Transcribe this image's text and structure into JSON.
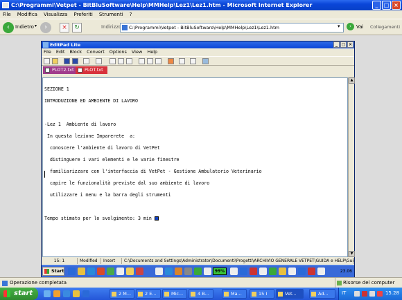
{
  "ie": {
    "title": "C:\\Programmi\\Vetpet - BitBluSoftware\\Help\\MMHelp\\Lez1\\Lez1.htm - Microsoft Internet Explorer",
    "menu": [
      "File",
      "Modifica",
      "Visualizza",
      "Preferiti",
      "Strumenti",
      "?"
    ],
    "back_label": "Indietro",
    "address_label": "Indirizzo",
    "address_value": "C:\\Programmi\\Vetpet - BitBluSoftware\\Help\\MMHelp\\Lez1\\Lez1.htm",
    "go_label": "Vai",
    "links_label": "Collegamenti",
    "status_text": "Operazione completata",
    "zone_text": "Risorse del computer"
  },
  "editpad": {
    "title": "EditPad Lite",
    "menu": [
      "File",
      "Edit",
      "Block",
      "Convert",
      "Options",
      "View",
      "Help"
    ],
    "tabs": [
      "PLOT2.txt",
      "PLOT.txt"
    ],
    "lines": [
      "SEZIONE 1",
      "INTRODUZIONE ED AMBIENTE DI LAVORO",
      "",
      "-Lez 1  Ambiente di lavoro",
      " In questa lezione Imparerete  a:",
      "  conoscere l'ambiente di lavoro di VetPet",
      "  distinguere i vari elementi e le varie finestre",
      "  familiarizzare con l'interfaccia di VetPet - Gestione Ambulatorio Veterinario",
      "  capire le funzionalità previste dal suo ambiente di lavoro",
      "  utilizzare i menu e la barra degli strumenti",
      "",
      "Tempo stimato per lo svolgimento: 3 min "
    ],
    "status": {
      "position": "15: 1",
      "modified": "Modified",
      "insert": "Insert",
      "path": "C:\\Documents and Settings\\Administrator\\Documenti\\Progetti\\ARCHIVIO GENERALE VETPET\\GUIDA e HELP\\Guida inte"
    },
    "inner_taskbar": {
      "start_label": "Start",
      "battery": "99%",
      "clock": "23.06"
    }
  },
  "taskbar": {
    "start_label": "start",
    "tasks": [
      "2 M...",
      "2 E...",
      "Mic...",
      "4 B...",
      "Ma...",
      "15 I",
      "Vet...",
      "Ad..."
    ],
    "lang": "IT",
    "clock": "15.28"
  }
}
